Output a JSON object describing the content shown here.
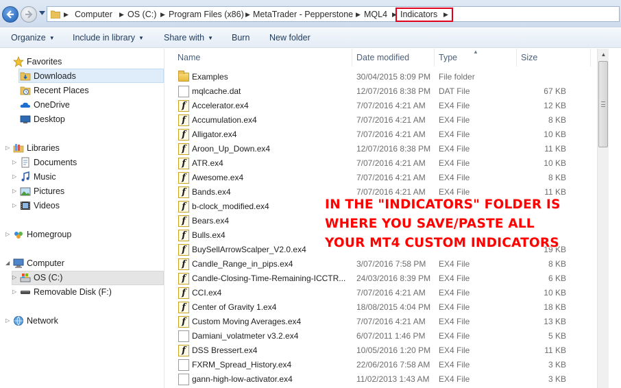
{
  "breadcrumb": [
    "Computer",
    "OS (C:)",
    "Program Files (x86)",
    "MetaTrader - Pepperstone",
    "MQL4",
    "Indicators"
  ],
  "toolbar": {
    "organize": "Organize",
    "include_in_library": "Include in library",
    "share_with": "Share with",
    "burn": "Burn",
    "new_folder": "New folder"
  },
  "nav": {
    "favorites": "Favorites",
    "downloads": "Downloads",
    "recent_places": "Recent Places",
    "onedrive": "OneDrive",
    "desktop": "Desktop",
    "libraries": "Libraries",
    "documents": "Documents",
    "music": "Music",
    "pictures": "Pictures",
    "videos": "Videos",
    "homegroup": "Homegroup",
    "computer": "Computer",
    "os_c": "OS (C:)",
    "removable": "Removable Disk (F:)",
    "network": "Network"
  },
  "columns": {
    "name": "Name",
    "date_modified": "Date modified",
    "type": "Type",
    "size": "Size"
  },
  "files": [
    {
      "name": "Examples",
      "date": "30/04/2015 8:09 PM",
      "type": "File folder",
      "size": "",
      "icon": "folder"
    },
    {
      "name": "mqlcache.dat",
      "date": "12/07/2016 8:38 PM",
      "type": "DAT File",
      "size": "67 KB",
      "icon": "doc"
    },
    {
      "name": "Accelerator.ex4",
      "date": "7/07/2016 4:21 AM",
      "type": "EX4 File",
      "size": "12 KB",
      "icon": "ex4"
    },
    {
      "name": "Accumulation.ex4",
      "date": "7/07/2016 4:21 AM",
      "type": "EX4 File",
      "size": "8 KB",
      "icon": "ex4"
    },
    {
      "name": "Alligator.ex4",
      "date": "7/07/2016 4:21 AM",
      "type": "EX4 File",
      "size": "10 KB",
      "icon": "ex4"
    },
    {
      "name": "Aroon_Up_Down.ex4",
      "date": "12/07/2016 8:38 PM",
      "type": "EX4 File",
      "size": "11 KB",
      "icon": "ex4"
    },
    {
      "name": "ATR.ex4",
      "date": "7/07/2016 4:21 AM",
      "type": "EX4 File",
      "size": "10 KB",
      "icon": "ex4"
    },
    {
      "name": "Awesome.ex4",
      "date": "7/07/2016 4:21 AM",
      "type": "EX4 File",
      "size": "8 KB",
      "icon": "ex4"
    },
    {
      "name": "Bands.ex4",
      "date": "7/07/2016 4:21 AM",
      "type": "EX4 File",
      "size": "11 KB",
      "icon": "ex4"
    },
    {
      "name": "b-clock_modified.ex4",
      "date": "",
      "type": "",
      "size": "",
      "icon": "ex4"
    },
    {
      "name": "Bears.ex4",
      "date": "",
      "type": "",
      "size": "",
      "icon": "ex4"
    },
    {
      "name": "Bulls.ex4",
      "date": "",
      "type": "",
      "size": "",
      "icon": "ex4"
    },
    {
      "name": "BuySellArrowScalper_V2.0.ex4",
      "date": "",
      "type": "",
      "size": "19 KB",
      "icon": "ex4"
    },
    {
      "name": "Candle_Range_in_pips.ex4",
      "date": "3/07/2016 7:58 PM",
      "type": "EX4 File",
      "size": "8 KB",
      "icon": "ex4"
    },
    {
      "name": "Candle-Closing-Time-Remaining-ICCTR...",
      "date": "24/03/2016 8:39 PM",
      "type": "EX4 File",
      "size": "6 KB",
      "icon": "ex4"
    },
    {
      "name": "CCI.ex4",
      "date": "7/07/2016 4:21 AM",
      "type": "EX4 File",
      "size": "10 KB",
      "icon": "ex4"
    },
    {
      "name": "Center of Gravity 1.ex4",
      "date": "18/08/2015 4:04 PM",
      "type": "EX4 File",
      "size": "18 KB",
      "icon": "ex4"
    },
    {
      "name": "Custom Moving Averages.ex4",
      "date": "7/07/2016 4:21 AM",
      "type": "EX4 File",
      "size": "13 KB",
      "icon": "ex4"
    },
    {
      "name": "Damiani_volatmeter v3.2.ex4",
      "date": "6/07/2011 1:46 PM",
      "type": "EX4 File",
      "size": "5 KB",
      "icon": "doc"
    },
    {
      "name": "DSS Bressert.ex4",
      "date": "10/05/2016 1:20 PM",
      "type": "EX4 File",
      "size": "11 KB",
      "icon": "ex4"
    },
    {
      "name": "FXRM_Spread_History.ex4",
      "date": "22/06/2016 7:58 AM",
      "type": "EX4 File",
      "size": "3 KB",
      "icon": "doc"
    },
    {
      "name": "gann-high-low-activator.ex4",
      "date": "11/02/2013 1:43 AM",
      "type": "EX4 File",
      "size": "3 KB",
      "icon": "doc"
    }
  ],
  "annotation": {
    "line1": "IN THE \"INDICATORS\" FOLDER IS",
    "line2": "WHERE YOU SAVE/PASTE ALL",
    "line3": "YOUR MT4 CUSTOM INDICATORS",
    "color": "#ff0000"
  },
  "colors": {
    "highlight_border": "#e0001b",
    "toolbar_text": "#1e395b",
    "selected_bg": "#dfedfb"
  }
}
